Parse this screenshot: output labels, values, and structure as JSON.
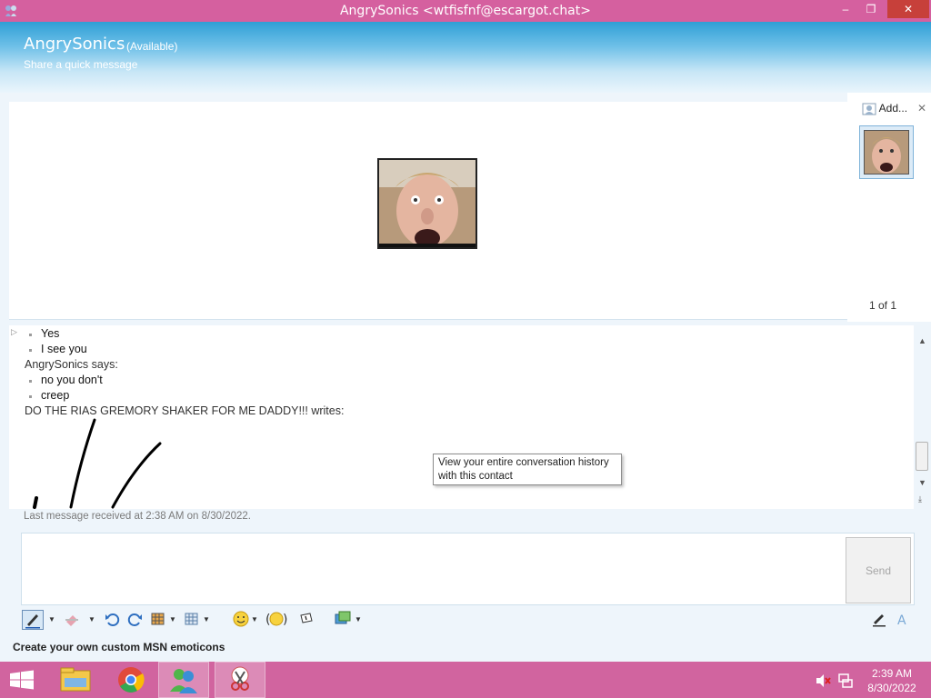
{
  "window": {
    "title": "AngrySonics <wtfisfnf@escargot.chat>",
    "min_glyph": "–",
    "max_glyph": "❐",
    "close_glyph": "✕"
  },
  "header": {
    "name": "AngrySonics",
    "status": "(Available)",
    "personal_message": "Share a quick message"
  },
  "side_pane": {
    "add_label": "Add...",
    "close_glyph": "✕",
    "pager": "1 of 1"
  },
  "conversation": {
    "lines": {
      "l0": "Yes",
      "l1": "I see you",
      "l2": "AngrySonics says:",
      "l3": "no you don't",
      "l4": "creep",
      "l5": "DO THE RIAS GREMORY SHAKER FOR ME DADDY!!! writes:"
    },
    "last_received": "Last message received at 2:38 AM on 8/30/2022."
  },
  "tooltip": {
    "line1": "View your entire conversation history",
    "line2": "with this contact"
  },
  "compose": {
    "send_label": "Send"
  },
  "promo": "Create your own custom MSN emoticons",
  "taskbar": {
    "time": "2:39 AM",
    "date": "8/30/2022"
  },
  "colors": {
    "titlebar": "#d5609f",
    "taskbar": "#d1649f",
    "header_top": "#2f9fd6"
  }
}
